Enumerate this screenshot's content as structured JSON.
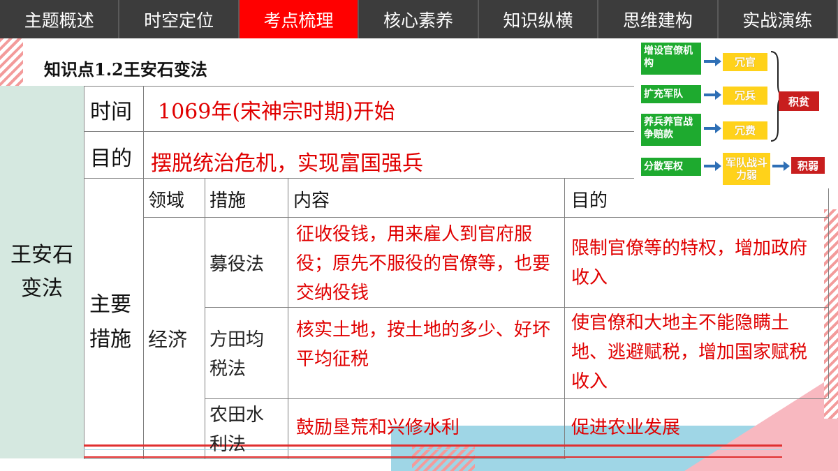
{
  "nav": {
    "tabs": [
      {
        "label": "主题概述",
        "active": false
      },
      {
        "label": "时空定位",
        "active": false
      },
      {
        "label": "考点梳理",
        "active": true
      },
      {
        "label": "核心素养",
        "active": false
      },
      {
        "label": "知识纵横",
        "active": false
      },
      {
        "label": "思维建构",
        "active": false
      },
      {
        "label": "实战演练",
        "active": false
      }
    ]
  },
  "section_title": "知识点1.2王安石变法",
  "left_label": "王安石变法",
  "table": {
    "time_label": "时间",
    "time_value": "1069年(宋神宗时期)开始",
    "purpose_label": "目的",
    "purpose_value": "摆脱统治危机，实现富国强兵",
    "measures_label": "主要措施",
    "headers": [
      "领域",
      "措施",
      "内容",
      "目的"
    ],
    "domain": "经济",
    "rows": [
      {
        "measure": "募役法",
        "content": "征收役钱，用来雇人到官府服役；原先不服役的官僚等，也要交纳役钱",
        "purpose": "限制官僚等的特权，增加政府收入"
      },
      {
        "measure": "方田均税法",
        "content": "核实土地，按土地的多少、好坏平均征税",
        "purpose": "使官僚和大地主不能隐瞒土地、逃避赋税，增加国家赋税收入"
      },
      {
        "measure": "农田水利法",
        "content": "鼓励垦荒和兴修水利",
        "purpose": "促进农业发展"
      }
    ]
  },
  "diagram": {
    "causes": [
      "增设官僚机构",
      "扩充军队",
      "养兵养官战争赔款",
      "分散军权"
    ],
    "effects": [
      "冗官",
      "冗兵",
      "冗费",
      "军队战斗力弱"
    ],
    "results": [
      "积贫",
      "积弱"
    ],
    "colors": {
      "cause": "#1eaa2f",
      "effect": "#ffd21a",
      "result": "#c81e1e",
      "arrow": "#2e6fb5"
    }
  }
}
